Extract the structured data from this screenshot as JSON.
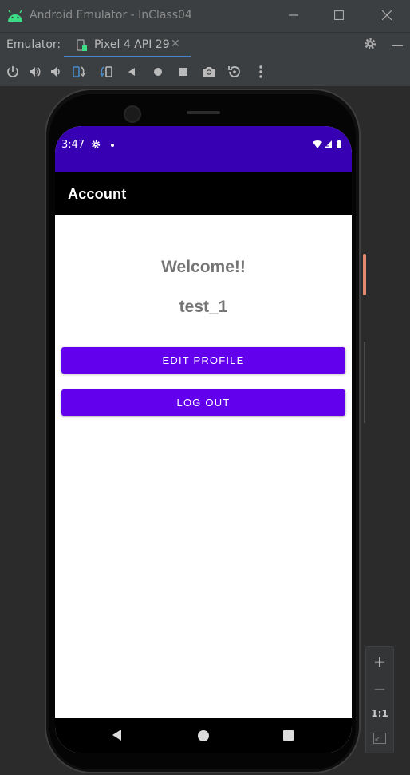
{
  "window": {
    "title": "Android Emulator - InClass04"
  },
  "tabbar": {
    "label": "Emulator:",
    "tab_name": "Pixel 4 API 29",
    "close_glyph": "✕"
  },
  "toolbar": {
    "icons": [
      "power-icon",
      "volume-up-icon",
      "volume-down-icon",
      "rotate-left-icon",
      "rotate-right-icon",
      "back-icon",
      "home-icon",
      "overview-icon",
      "screenshot-icon",
      "snapshot-icon",
      "more-icon"
    ]
  },
  "device": {
    "status_bar": {
      "time": "3:47",
      "color": "#3700b3"
    },
    "app_bar": {
      "title": "Account"
    },
    "content": {
      "welcome": "Welcome!!",
      "username": "test_1",
      "edit_profile_button": "EDIT PROFILE",
      "logout_button": "LOG OUT",
      "button_color": "#6200ee"
    }
  },
  "zoom_panel": {
    "zoom_in": "+",
    "zoom_out": "−",
    "actual_size": "1:1"
  },
  "colors": {
    "ide_background": "#2b2b2b",
    "ide_chrome": "#3c3f41",
    "tab_underline": "#4a88c7"
  }
}
